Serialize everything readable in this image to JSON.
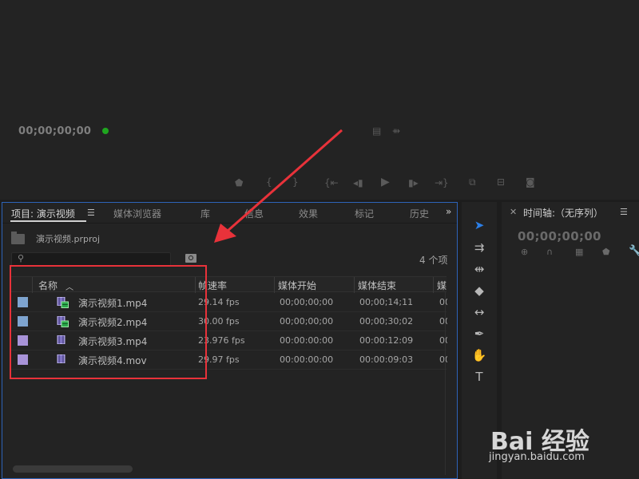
{
  "colors": {
    "accent": "#2e63b8",
    "highlight": "#e8323a",
    "status_green": "#1fa61f",
    "label_blue": "#7ea4cf",
    "label_violet": "#a893d8"
  },
  "monitor": {
    "timecode": "00;00;00;00",
    "icons": [
      "film-icon",
      "audio-waveform-icon",
      "marker-icon",
      "mark-in-icon",
      "mark-out-icon",
      "go-to-in-icon",
      "step-back-icon",
      "play-icon",
      "step-forward-icon",
      "go-to-out-icon",
      "insert-icon",
      "overwrite-icon",
      "camera-icon"
    ]
  },
  "project": {
    "tabs": [
      {
        "label": "项目: 演示视频"
      },
      {
        "label": "媒体浏览器"
      },
      {
        "label": "库"
      },
      {
        "label": "信息"
      },
      {
        "label": "效果"
      },
      {
        "label": "标记"
      },
      {
        "label": "历史"
      }
    ],
    "file_name": "演示视频.prproj",
    "search_placeholder": "",
    "item_count": "4 个项",
    "columns": [
      "名称",
      "帧速率",
      "媒体开始",
      "媒体结束",
      "媒"
    ],
    "rows": [
      {
        "name": "演示视频1.mp4",
        "fps": "29.14 fps",
        "start": "00;00;00;00",
        "end": "00;00;14;11",
        "extra": "00",
        "label_color": "#7ea4cf",
        "icon": "video-audio-clip-icon"
      },
      {
        "name": "演示视频2.mp4",
        "fps": "30.00 fps",
        "start": "00;00;00;00",
        "end": "00;00;30;02",
        "extra": "00",
        "label_color": "#7ea4cf",
        "icon": "video-audio-clip-icon"
      },
      {
        "name": "演示视频3.mp4",
        "fps": "23.976 fps",
        "start": "00:00:00:00",
        "end": "00:00:12:09",
        "extra": "00",
        "label_color": "#a893d8",
        "icon": "video-clip-icon"
      },
      {
        "name": "演示视频4.mov",
        "fps": "29.97 fps",
        "start": "00:00:00:00",
        "end": "00:00:09:03",
        "extra": "00",
        "label_color": "#a893d8",
        "icon": "video-clip-icon"
      }
    ]
  },
  "tools": [
    {
      "name": "selection-tool",
      "glyph": "➤",
      "active": true
    },
    {
      "name": "track-select-tool",
      "glyph": "⇉",
      "active": false
    },
    {
      "name": "ripple-edit-tool",
      "glyph": "⇹",
      "active": false
    },
    {
      "name": "razor-tool",
      "glyph": "◆",
      "active": false
    },
    {
      "name": "slip-tool",
      "glyph": "↔",
      "active": false
    },
    {
      "name": "pen-tool",
      "glyph": "✒",
      "active": false
    },
    {
      "name": "hand-tool",
      "glyph": "✋",
      "active": false
    },
    {
      "name": "type-tool",
      "glyph": "T",
      "active": false
    }
  ],
  "timeline": {
    "title": "时间轴:（无序列）",
    "timecode": "00;00;00;00"
  },
  "watermark": {
    "logo_text": "Bai 经验",
    "url": "jingyan.baidu.com"
  }
}
